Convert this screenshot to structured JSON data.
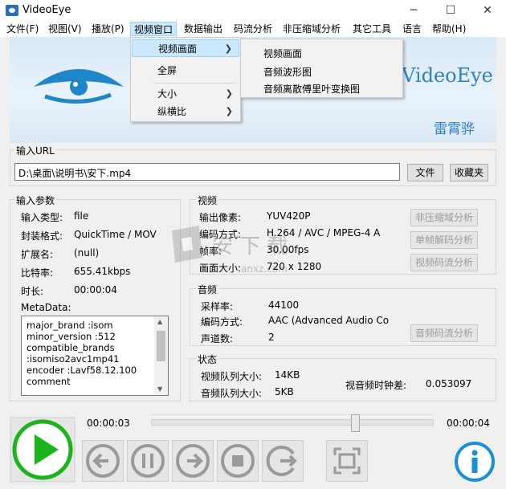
{
  "window": {
    "title": "VideoEye"
  },
  "menu": [
    "文件(F)",
    "视图(V)",
    "播放(P)",
    "视频窗口",
    "数据输出",
    "码流分析",
    "非压缩域分析",
    "其它工具",
    "语言",
    "帮助(H)"
  ],
  "dropdown": {
    "items": [
      "视频画面",
      "全屏",
      "大小",
      "纵横比"
    ]
  },
  "submenu": {
    "items": [
      "视频画面",
      "音频波形图",
      "音频离散傅里叶变换图"
    ]
  },
  "banner": {
    "brand": "VideoEye",
    "subtitle": "雷霄骅"
  },
  "input_url": {
    "group_title": "输入URL",
    "value": "D:\\桌面\\说明书\\安下.mp4",
    "file_button": "文件",
    "favorites_button": "收藏夹"
  },
  "input_params": {
    "group_title": "输入参数",
    "rows": [
      {
        "label": "输入类型:",
        "value": "file"
      },
      {
        "label": "封装格式:",
        "value": "QuickTime / MOV"
      },
      {
        "label": "扩展名:",
        "value": "(null)"
      },
      {
        "label": "比特率:",
        "value": "655.41kbps"
      },
      {
        "label": "时长:",
        "value": "00:00:04"
      }
    ],
    "metadata_label": "MetaData:",
    "metadata_lines": [
      "major_brand      :isom",
      "minor_version     :512",
      "compatible_brands",
      ":isomiso2avc1mp41",
      "encoder   :Lavf58.12.100",
      "comment"
    ]
  },
  "video": {
    "group_title": "视频",
    "rows": [
      {
        "label": "输出像素:",
        "value": "YUV420P"
      },
      {
        "label": "编码方式:",
        "value": "H.264 / AVC / MPEG-4 A"
      },
      {
        "label": "帧率:",
        "value": "30.00fps"
      },
      {
        "label": "画面大小:",
        "value": "720 x 1280"
      }
    ],
    "buttons": [
      "非压缩域分析",
      "单帧解码分析",
      "视频码流分析"
    ]
  },
  "audio": {
    "group_title": "音频",
    "rows": [
      {
        "label": "采样率:",
        "value": "44100"
      },
      {
        "label": "编码方式:",
        "value": "AAC (Advanced Audio Co"
      },
      {
        "label": "声道数:",
        "value": "2"
      }
    ],
    "button": "音频码流分析"
  },
  "status": {
    "group_title": "状态",
    "video_queue_label": "视频队列大小:",
    "video_queue_value": "14KB",
    "audio_queue_label": "音频队列大小:",
    "audio_queue_value": "5KB",
    "av_diff_label": "视音频时钟差:",
    "av_diff_value": "0.053097"
  },
  "playback": {
    "current_time": "00:00:03",
    "total_time": "00:00:04",
    "progress": 0.75
  },
  "watermark": {
    "text": "安 下 载",
    "sub": "anxz.com"
  },
  "colors": {
    "accent": "#2f7fc4",
    "play": "#1db31d",
    "info": "#1a8fd6",
    "menu_highlight": "#cce8ff"
  }
}
